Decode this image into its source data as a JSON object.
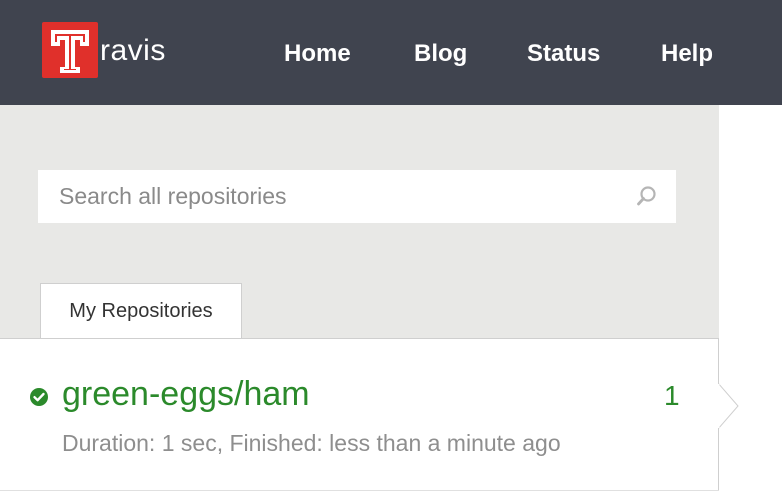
{
  "header": {
    "logo_text": "ravis",
    "logo_letter": "T",
    "logo_color": "#e0302b",
    "background": "#40444f",
    "nav": [
      {
        "label": "Home"
      },
      {
        "label": "Blog"
      },
      {
        "label": "Status"
      },
      {
        "label": "Help"
      }
    ]
  },
  "sidebar": {
    "search": {
      "placeholder": "Search all repositories",
      "value": "",
      "icon": "search-icon"
    },
    "tabs": [
      {
        "label": "My Repositories",
        "active": true
      }
    ],
    "repositories": [
      {
        "name": "green-eggs/ham",
        "build_number": "1",
        "status": "passed",
        "status_icon": "check-circle-icon",
        "status_color": "#2b8a2b",
        "meta": "Duration: 1 sec, Finished: less than a minute ago"
      }
    ]
  }
}
